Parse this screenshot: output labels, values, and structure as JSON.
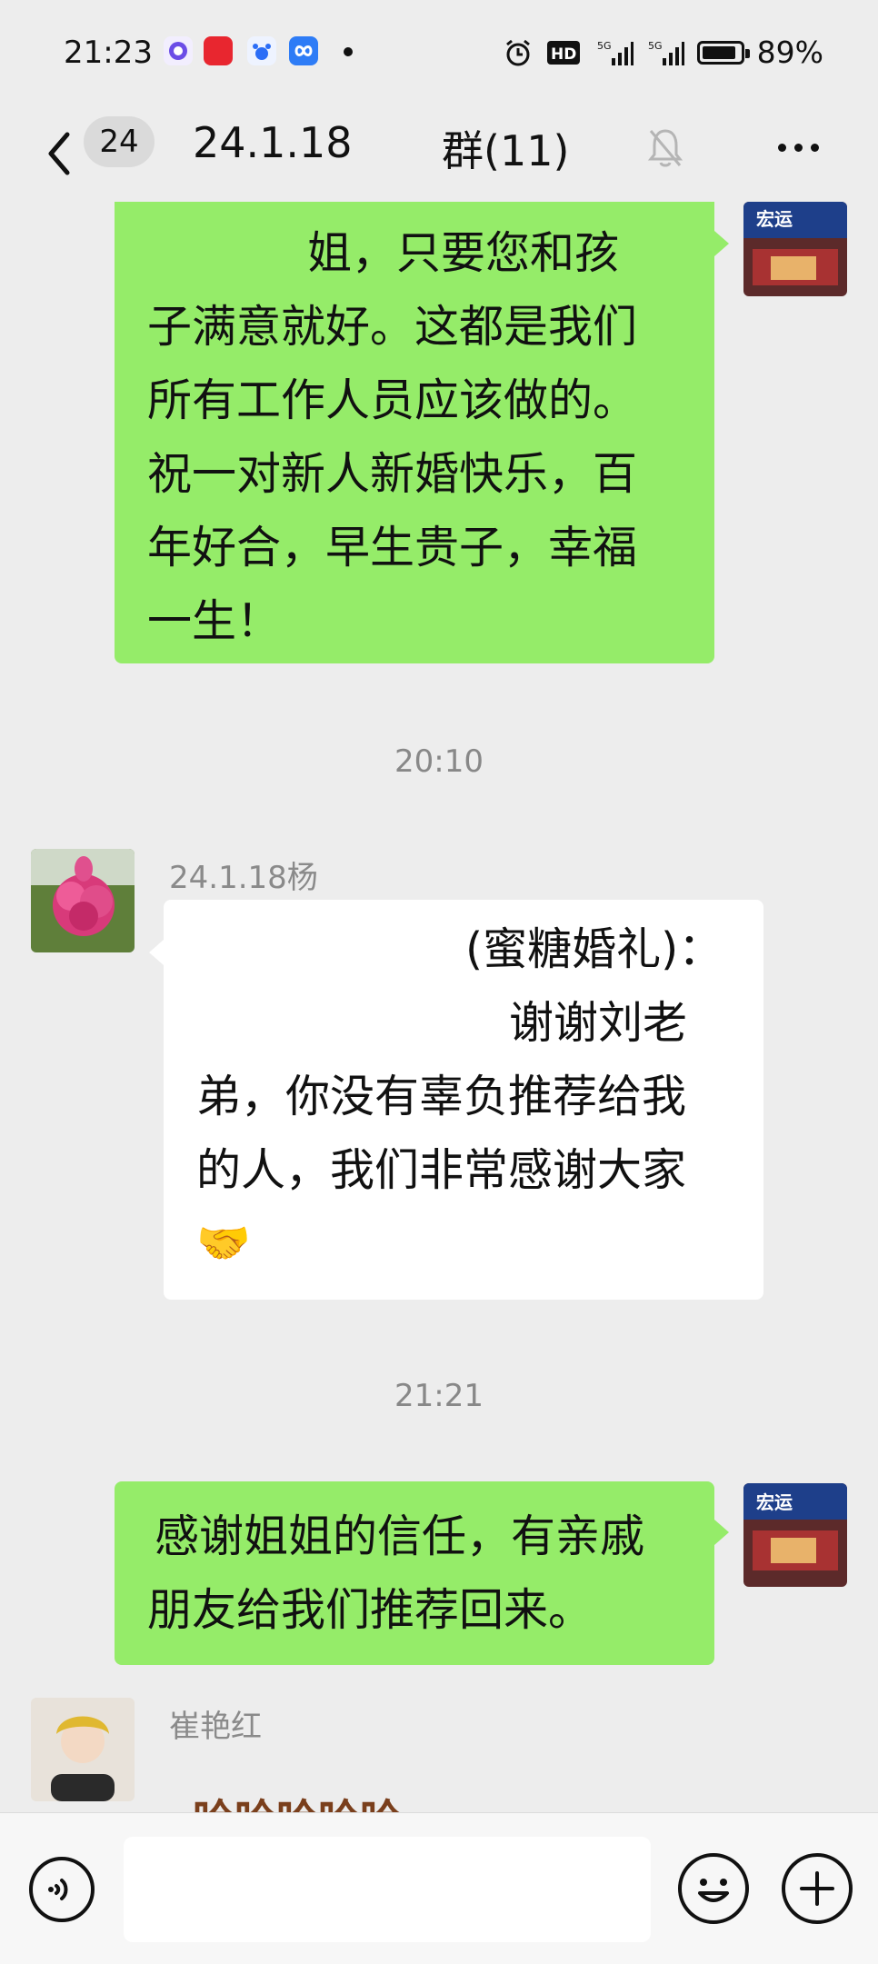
{
  "status_bar": {
    "time": "21:23",
    "network": "HD 5G 5G",
    "battery_pct": "89%",
    "battery_level": 0.89
  },
  "nav": {
    "unread_count": "24",
    "title_left": "24.1.18",
    "title_right": "群(11)",
    "muted": true
  },
  "messages": {
    "m1": {
      "lines": [
        "姐，只要您和孩",
        "子满意就好。这都是我们",
        "所有工作人员应该做的。",
        "祝一对新人新婚快乐，百",
        "年好合，早生贵子，幸福",
        "一生！"
      ]
    },
    "t1": "20:10",
    "m2": {
      "sender": "24.1.18杨",
      "lines": [
        "(蜜糖婚礼)：",
        "谢谢刘老",
        "弟，你没有辜负推荐给我",
        "的人，我们非常感谢大家",
        "🤝"
      ]
    },
    "t2": "21:21",
    "m3": {
      "lines": [
        "感谢姐姐的信任，有亲戚",
        "朋友给我们推荐回来。"
      ]
    },
    "m4": {
      "sender": "崔艳红",
      "preview": "哈哈哈哈哈"
    }
  },
  "input": {
    "placeholder": ""
  }
}
